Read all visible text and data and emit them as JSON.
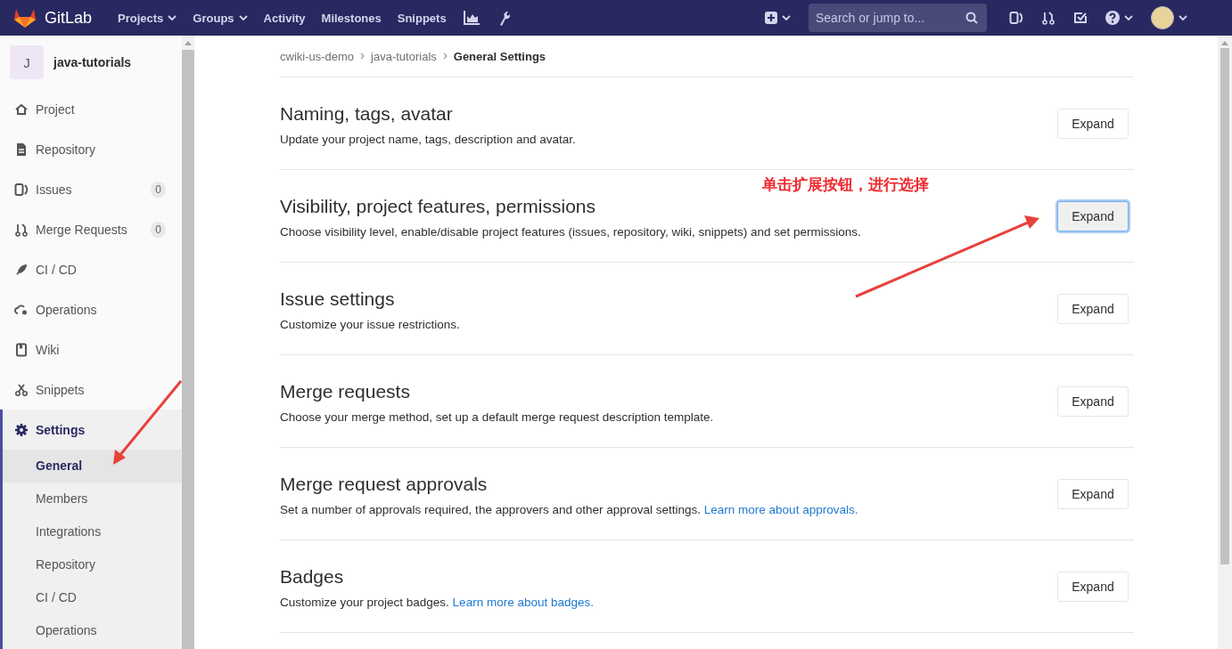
{
  "header": {
    "logo": "GitLab",
    "nav": [
      {
        "label": "Projects",
        "dropdown": true
      },
      {
        "label": "Groups",
        "dropdown": true
      },
      {
        "label": "Activity",
        "dropdown": false
      },
      {
        "label": "Milestones",
        "dropdown": false
      },
      {
        "label": "Snippets",
        "dropdown": false
      }
    ],
    "search": {
      "placeholder": "Search or jump to..."
    }
  },
  "sidebar": {
    "project": {
      "avatar_letter": "J",
      "name": "java-tutorials"
    },
    "items": [
      {
        "kind": "project",
        "label": "Project",
        "selected": false
      },
      {
        "kind": "repository",
        "label": "Repository",
        "selected": false
      },
      {
        "kind": "issues",
        "label": "Issues",
        "count": "0",
        "selected": false
      },
      {
        "kind": "merge",
        "label": "Merge Requests",
        "count": "0",
        "selected": false
      },
      {
        "kind": "cicd",
        "label": "CI / CD",
        "selected": false
      },
      {
        "kind": "operations",
        "label": "Operations",
        "selected": false
      },
      {
        "kind": "wiki",
        "label": "Wiki",
        "selected": false
      },
      {
        "kind": "snippets",
        "label": "Snippets",
        "selected": false
      },
      {
        "kind": "settings",
        "label": "Settings",
        "selected": true,
        "children": [
          {
            "label": "General",
            "selected": true
          },
          {
            "label": "Members",
            "selected": false
          },
          {
            "label": "Integrations",
            "selected": false
          },
          {
            "label": "Repository",
            "selected": false
          },
          {
            "label": "CI / CD",
            "selected": false
          },
          {
            "label": "Operations",
            "selected": false
          }
        ]
      }
    ]
  },
  "breadcrumb": [
    {
      "label": "cwiki-us-demo"
    },
    {
      "label": "java-tutorials"
    },
    {
      "label": "General Settings"
    }
  ],
  "sections": [
    {
      "title": "Naming, tags, avatar",
      "description": "Update your project name, tags, description and avatar.",
      "button": "Expand",
      "focused": false
    },
    {
      "title": "Visibility, project features, permissions",
      "description": "Choose visibility level, enable/disable project features (issues, repository, wiki, snippets) and set permissions.",
      "button": "Expand",
      "focused": true
    },
    {
      "title": "Issue settings",
      "description": "Customize your issue restrictions.",
      "button": "Expand",
      "focused": false
    },
    {
      "title": "Merge requests",
      "description": "Choose your merge method, set up a default merge request description template.",
      "button": "Expand",
      "focused": false
    },
    {
      "title": "Merge request approvals",
      "description": "Set a number of approvals required, the approvers and other approval settings.",
      "link": "Learn more about approvals.",
      "button": "Expand",
      "focused": false
    },
    {
      "title": "Badges",
      "description": "Customize your project badges.",
      "link": "Learn more about badges.",
      "button": "Expand",
      "focused": false
    }
  ],
  "annotation": {
    "text": "单击扩展按钮，进行选择"
  }
}
